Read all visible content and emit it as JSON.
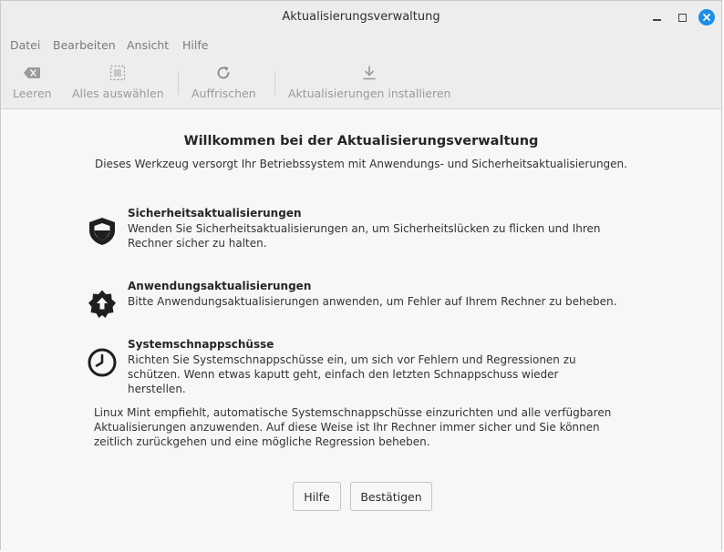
{
  "window": {
    "title": "Aktualisierungsverwaltung",
    "close_color": "#1c8fe6"
  },
  "menubar": {
    "items": [
      "Datei",
      "Bearbeiten",
      "Ansicht",
      "Hilfe"
    ]
  },
  "toolbar": {
    "clear_label": "Leeren",
    "select_all_label": "Alles auswählen",
    "refresh_label": "Auffrischen",
    "install_label": "Aktualisierungen installieren"
  },
  "welcome": {
    "title": "Willkommen bei der Aktualisierungsverwaltung",
    "subtitle": "Dieses Werkzeug versorgt Ihr Betriebssystem mit Anwendungs- und Sicherheitsaktualisierungen.",
    "features": [
      {
        "icon": "shield-icon",
        "title": "Sicherheitsaktualisierungen",
        "description": "Wenden Sie Sicherheitsaktualisierungen an, um Sicherheitslücken zu flicken und Ihren Rechner sicher zu halten."
      },
      {
        "icon": "package-upgrade-icon",
        "title": "Anwendungsaktualisierungen",
        "description": "Bitte Anwendungsaktualisierungen anwenden, um Fehler auf Ihrem Rechner zu beheben."
      },
      {
        "icon": "clock-icon",
        "title": "Systemschnappschüsse",
        "description": "Richten Sie Systemschnappschüsse ein, um sich vor Fehlern und Regressionen zu schützen. Wenn etwas kaputt geht, einfach den letzten Schnappschuss wieder herstellen."
      }
    ],
    "recommendation": "Linux Mint empfiehlt, automatische Systemschnappschüsse einzurichten und alle verfügbaren Aktualisierungen anzuwenden. Auf diese Weise ist Ihr Rechner immer sicher und Sie können zeitlich zurückgehen und eine mögliche Regression beheben.",
    "help_button": "Hilfe",
    "confirm_button": "Bestätigen"
  }
}
